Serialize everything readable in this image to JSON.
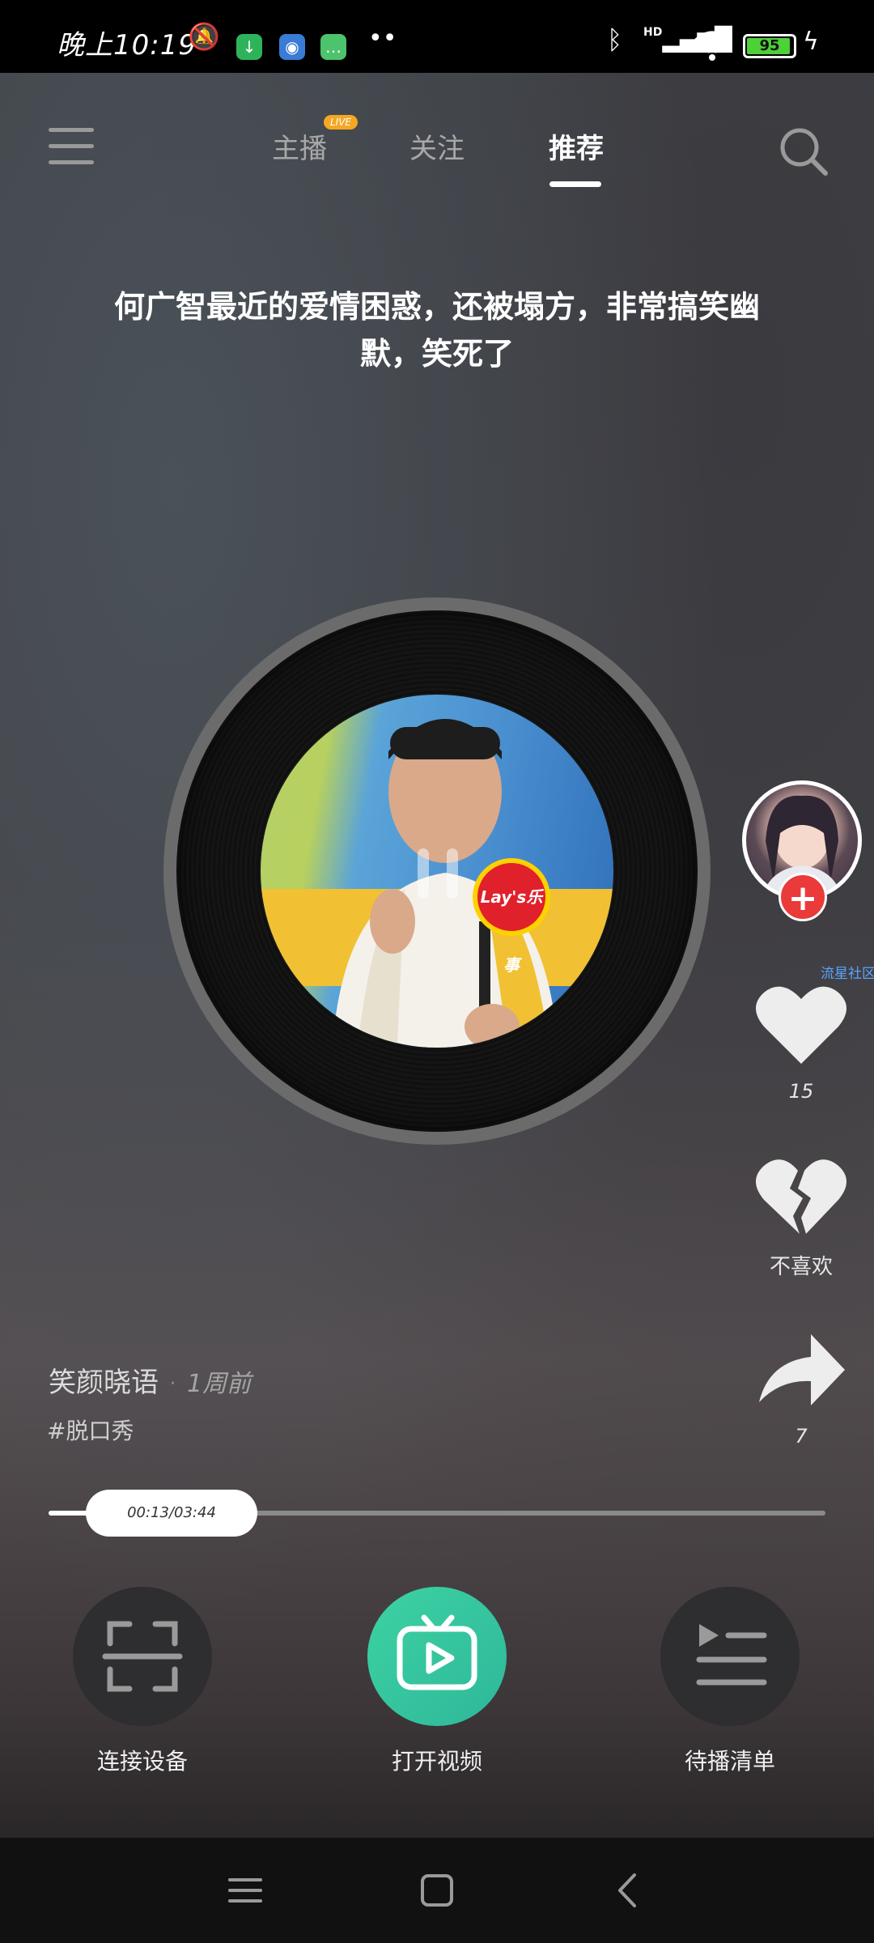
{
  "status_bar": {
    "time": "晚上10:19",
    "battery_level": "95",
    "battery_fraction": 0.95,
    "signal": "HD",
    "icons": [
      "mute-icon",
      "download-app-icon",
      "browser-app-icon",
      "messages-app-icon",
      "more-dots-icon",
      "bluetooth-icon",
      "signal-icon",
      "wifi-icon",
      "battery-icon",
      "charging-icon"
    ]
  },
  "header": {
    "tabs": [
      {
        "label": "主播",
        "active": false,
        "badge": "LIVE"
      },
      {
        "label": "关注",
        "active": false
      },
      {
        "label": "推荐",
        "active": true
      }
    ],
    "menu_icon": "hamburger-menu-icon",
    "search_icon": "search-icon"
  },
  "video": {
    "title": "何广智最近的爱情困惑，还被塌方，非常搞笑幽默，笑死了",
    "cover_badge": "Lay's乐事",
    "state": "paused"
  },
  "side_rail": {
    "follow_symbol": "+",
    "community_tag": "流星社区",
    "likes": "15",
    "dislike_label": "不喜欢",
    "shares": "7"
  },
  "author": {
    "name": "笑颜晓语",
    "separator": "·",
    "posted": "1周前",
    "hashtag": "#脱口秀"
  },
  "progress": {
    "time_label": "00:13/03:44",
    "fraction": 0.058
  },
  "actions": {
    "connect_label": "连接设备",
    "open_video_label": "打开视频",
    "queue_label": "待播清单"
  },
  "colors": {
    "accent_green": "#3dd2a3",
    "follow_red": "#ea3a3a",
    "badge_orange": "#f5a623",
    "battery_green": "#4cd137"
  }
}
